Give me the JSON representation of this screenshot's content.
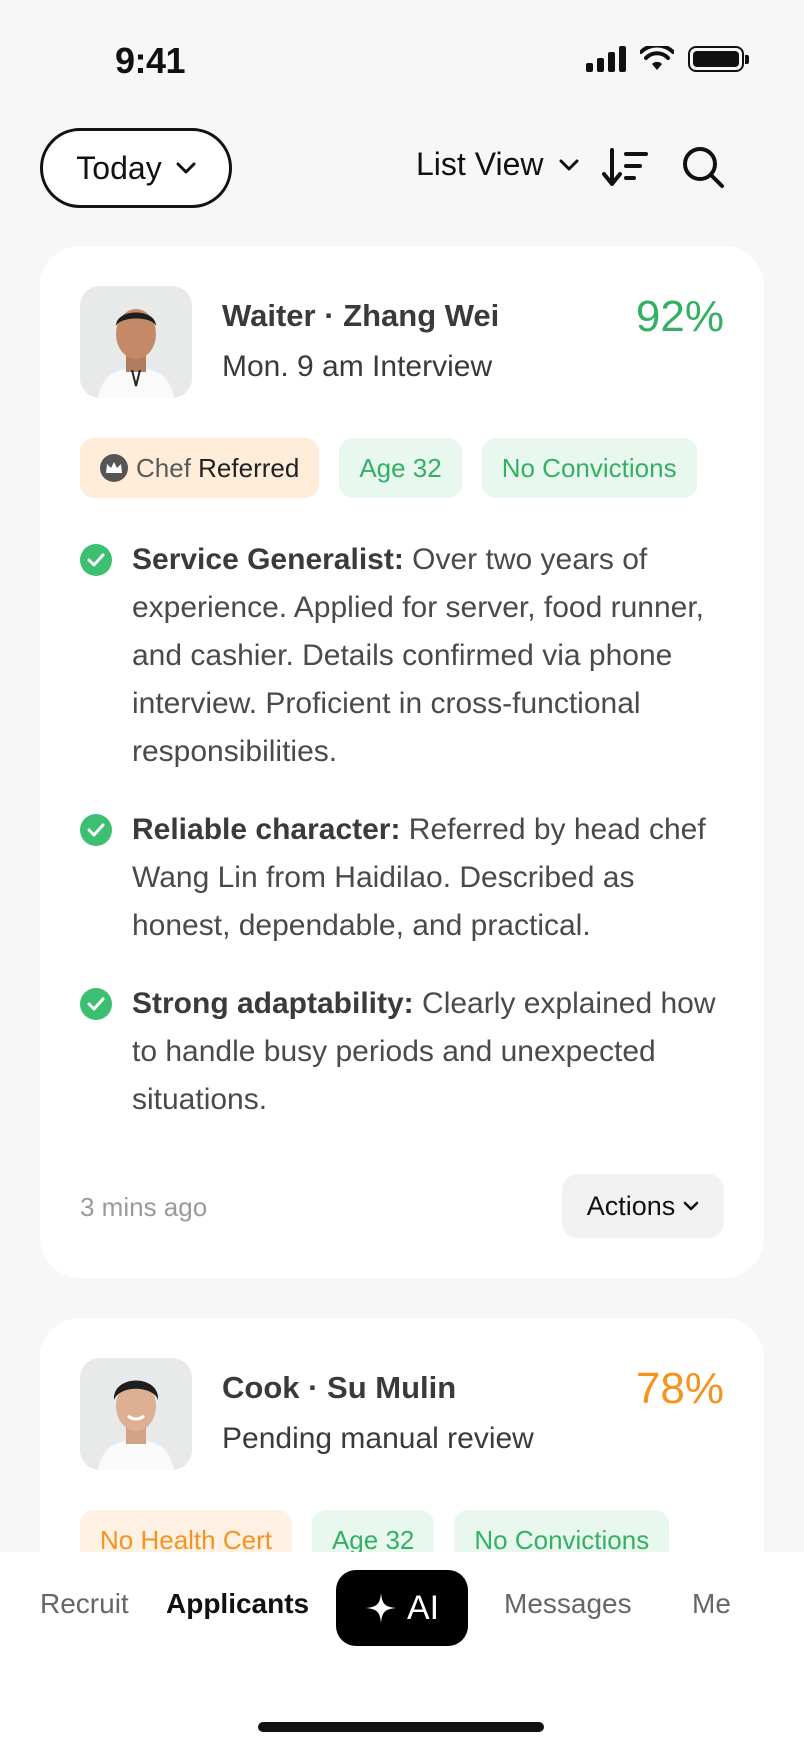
{
  "status_bar": {
    "time": "9:41",
    "icons": [
      "signal-icon",
      "wifi-icon",
      "battery-icon"
    ]
  },
  "toolbar": {
    "date_filter": "Today",
    "view_mode": "List View",
    "icons": [
      "chevron-down-icon",
      "sort-icon",
      "search-icon"
    ]
  },
  "applicants": [
    {
      "role_name": "Waiter · Zhang Wei",
      "subtitle": "Mon. 9 am Interview",
      "score": "92%",
      "score_color": "#34b065",
      "tags": [
        {
          "prefix": "Chef",
          "label": "Referred",
          "style": "orange",
          "icon": "crown-icon"
        },
        {
          "label": "Age 32",
          "style": "green"
        },
        {
          "label": "No Convictions",
          "style": "green"
        }
      ],
      "points": [
        {
          "title": "Service Generalist:",
          "text": " Over two years of experience. Applied for server, food runner, and cashier. Details confirmed via phone interview. Proficient in cross-functional responsibilities."
        },
        {
          "title": "Reliable character:",
          "text": " Referred by head chef Wang Lin from Haidilao. Described as honest, dependable, and practical."
        },
        {
          "title": "Strong adaptability:",
          "text": " Clearly explained how to handle busy periods and unexpected situations."
        }
      ],
      "time_ago": "3 mins ago",
      "actions_label": "Actions"
    },
    {
      "role_name": "Cook · Su Mulin",
      "subtitle": "Pending manual review",
      "score": "78%",
      "score_color": "#f5931e",
      "tags": [
        {
          "label": "No Health Cert",
          "style": "orange-text"
        },
        {
          "label": "Age 32",
          "style": "green"
        },
        {
          "label": "No Convictions",
          "style": "green"
        }
      ]
    }
  ],
  "bottom_nav": {
    "items": [
      "Recruit",
      "Applicants",
      "AI",
      "Messages",
      "Me"
    ],
    "active": "Applicants"
  }
}
